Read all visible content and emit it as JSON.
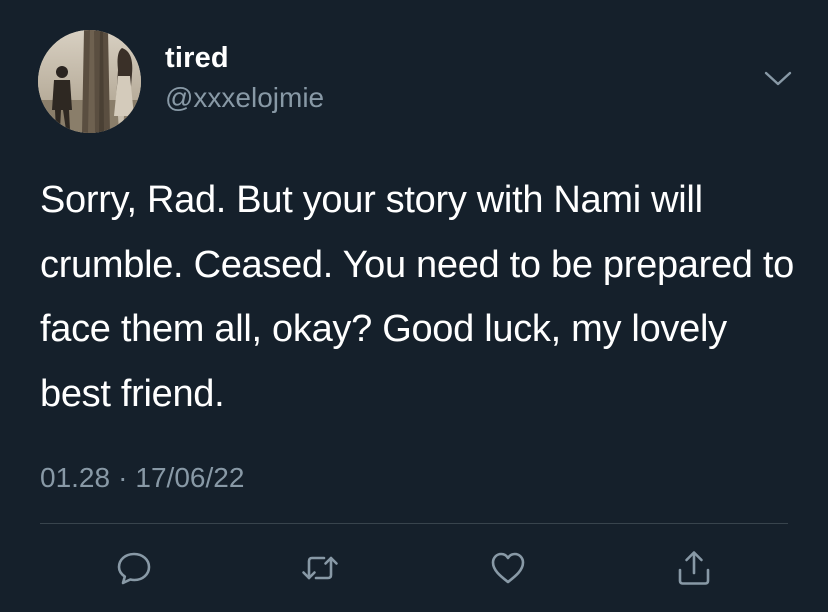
{
  "user": {
    "display_name": "tired",
    "handle": "@xxxelojmie"
  },
  "tweet": {
    "text": "Sorry, Rad. But your story with Nami will crumble. Ceased. You need to be prepared to face them all, okay? Good luck, my lovely best friend.",
    "time": "01.28",
    "separator": "·",
    "date": "17/06/22"
  },
  "icons": {
    "more": "chevron-down-icon",
    "reply": "comment-icon",
    "retweet": "retweet-icon",
    "like": "heart-icon",
    "share": "share-icon"
  },
  "colors": {
    "background": "#15202b",
    "primary_text": "#ffffff",
    "secondary_text": "#8899a6",
    "divider": "#38444d"
  }
}
